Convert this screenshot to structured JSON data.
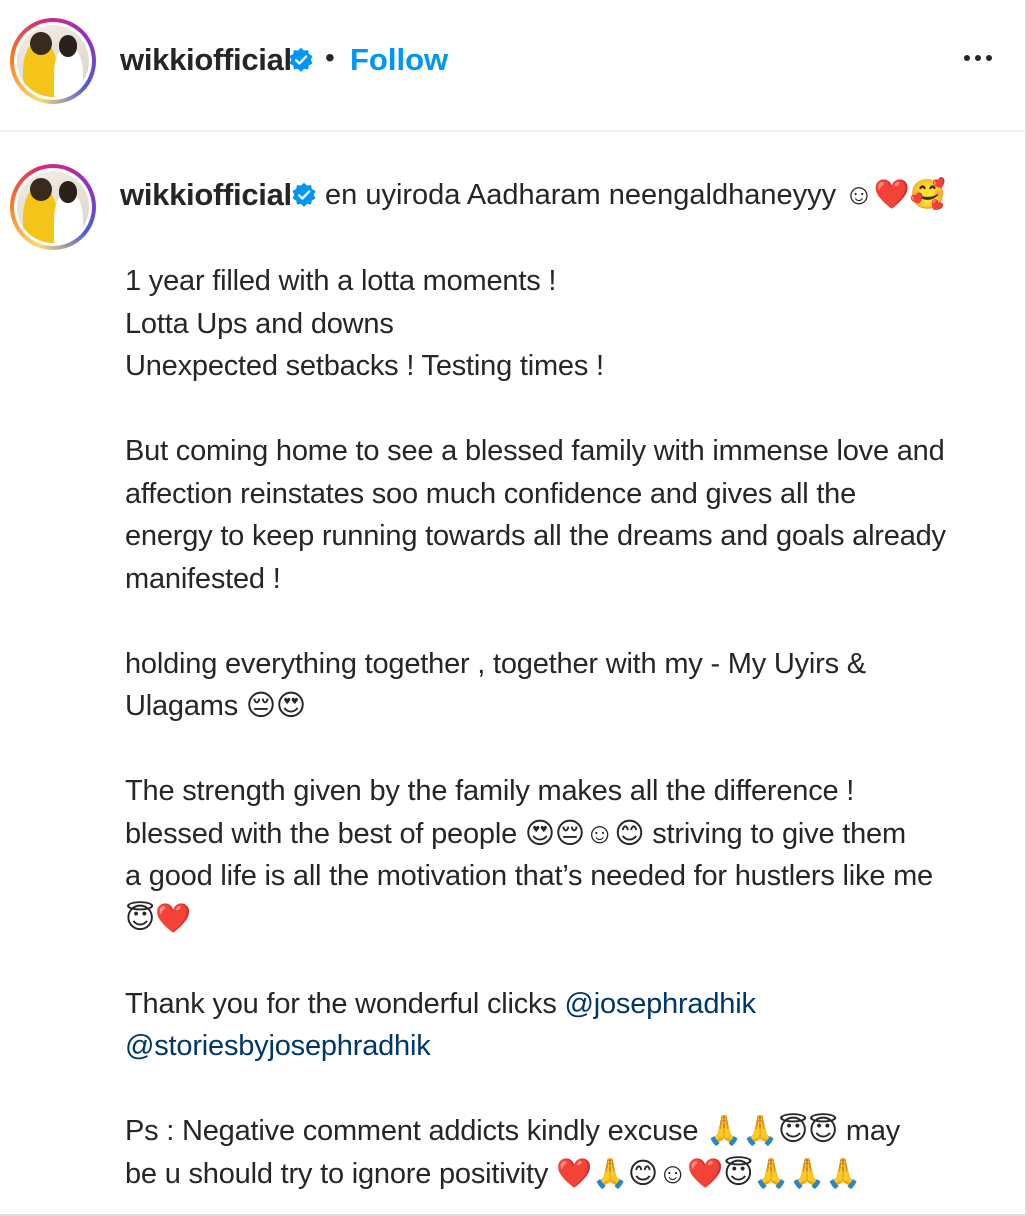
{
  "header": {
    "username": "wikkiofficial",
    "separator": "•",
    "follow_label": "Follow",
    "more_icon": "more-horizontal-icon"
  },
  "caption": {
    "username": "wikkiofficial",
    "first_line": "en uyiroda Aadharam neengaldhaneyyy ☺❤️🥰",
    "paragraphs": [
      "1 year filled with a lotta moments !\nLotta Ups and downs\nUnexpected setbacks ! Testing times !",
      "But coming home to see a blessed family with immense love and\naffection reinstates soo much confidence and gives all the\nenergy to keep running towards all the dreams and goals already\nmanifested !",
      "holding everything together , together with my - My Uyirs &\nUlagams 😔😍",
      "The strength given by the family makes all the difference !\nblessed with the best of people 😍😔☺😊 striving to give them\na good life is all the motivation that’s needed for hustlers like me\n😇❤️",
      "Ps : Negative comment addicts kindly excuse 🙏🙏😇😇 may\nbe u should try to ignore positivity ❤️🙏😊☺❤️😇🙏🙏🙏"
    ],
    "thanks_text": "Thank you for the wonderful clicks ",
    "mention_1": "@josephradhik",
    "mention_2": "@storiesbyjosephradhik"
  },
  "colors": {
    "accent": "#0095f6",
    "verified": "#0095f6",
    "mention": "#00376b",
    "text": "#262626"
  }
}
